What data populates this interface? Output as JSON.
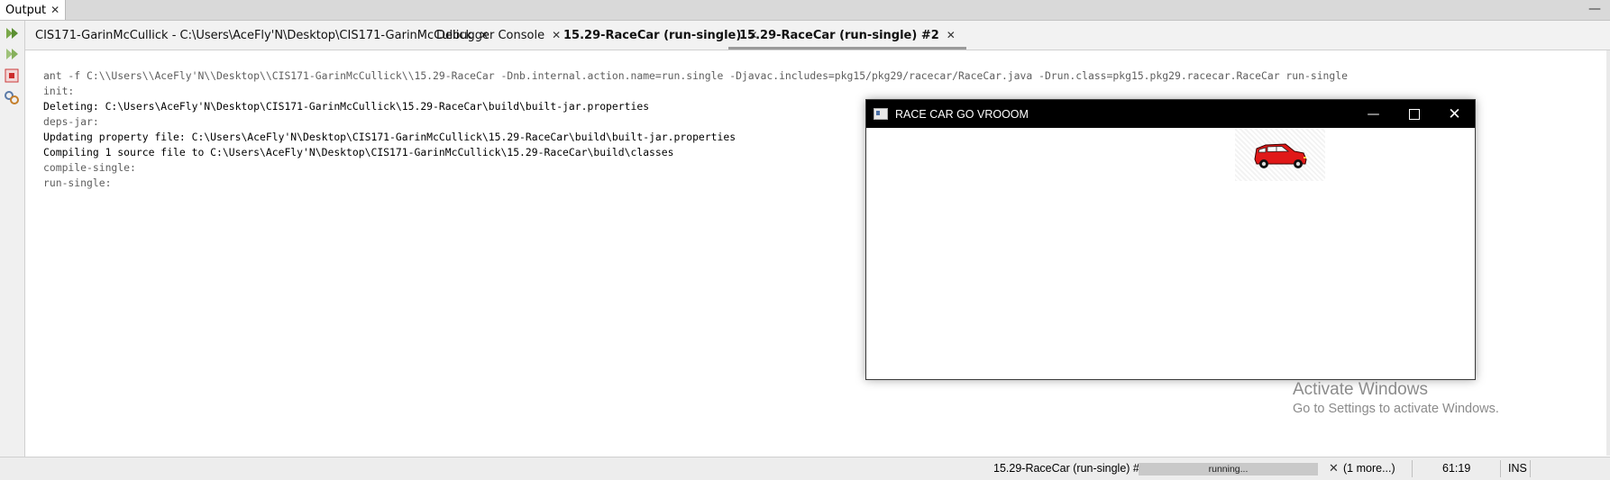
{
  "output_tab": {
    "label": "Output"
  },
  "tabs": [
    {
      "label": "CIS171-GarinMcCullick - C:\\Users\\AceFly'N\\Desktop\\CIS171-GarinMcCullick"
    },
    {
      "label": "Debugger Console"
    },
    {
      "label": "15.29-RaceCar (run-single)"
    },
    {
      "label": "15.29-RaceCar (run-single) #2"
    }
  ],
  "console": {
    "lines": [
      "ant -f C:\\\\Users\\\\AceFly'N\\\\Desktop\\\\CIS171-GarinMcCullick\\\\15.29-RaceCar -Dnb.internal.action.name=run.single -Djavac.includes=pkg15/pkg29/racecar/RaceCar.java -Drun.class=pkg15.pkg29.racecar.RaceCar run-single",
      "init:",
      "Deleting: C:\\Users\\AceFly'N\\Desktop\\CIS171-GarinMcCullick\\15.29-RaceCar\\build\\built-jar.properties",
      "deps-jar:",
      "Updating property file: C:\\Users\\AceFly'N\\Desktop\\CIS171-GarinMcCullick\\15.29-RaceCar\\build\\built-jar.properties",
      "Compiling 1 source file to C:\\Users\\AceFly'N\\Desktop\\CIS171-GarinMcCullick\\15.29-RaceCar\\build\\classes",
      "compile-single:",
      "run-single:"
    ]
  },
  "app_window": {
    "title": "RACE CAR GO VROOOM"
  },
  "watermark": {
    "title": "Activate Windows",
    "subtitle": "Go to Settings to activate Windows."
  },
  "status_bar": {
    "task": "15.29-RaceCar (run-single) #2",
    "progress_text": "running...",
    "more": "(1 more...)",
    "position": "61:19",
    "mode": "INS"
  },
  "colors": {
    "car_body": "#e01818",
    "title_bar": "#000000"
  }
}
